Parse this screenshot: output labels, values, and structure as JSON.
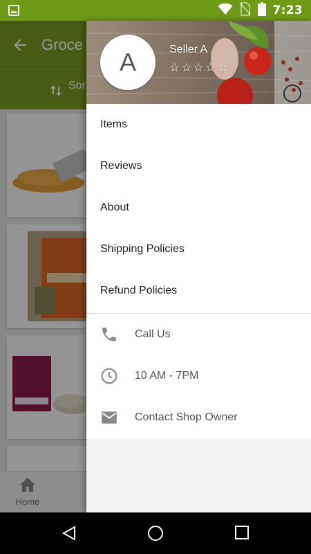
{
  "status_bar": {
    "time": "7:23"
  },
  "background_app": {
    "title": "Groce",
    "sort_label": "Sor",
    "bottom_nav": {
      "home_label": "Home"
    }
  },
  "drawer": {
    "header": {
      "avatar_letter": "A",
      "seller_name": "Seller A",
      "rating_stars": 0,
      "stars": [
        "☆",
        "☆",
        "☆",
        "☆",
        "☆"
      ]
    },
    "menu_items": [
      {
        "label": "Items"
      },
      {
        "label": "Reviews"
      },
      {
        "label": "About"
      },
      {
        "label": "Shipping Policies"
      },
      {
        "label": "Refund Policies"
      }
    ],
    "contact_items": [
      {
        "icon": "phone-icon",
        "label": "Call Us"
      },
      {
        "icon": "clock-icon",
        "label": "10 AM - 7PM"
      },
      {
        "icon": "mail-icon",
        "label": "Contact Shop Owner"
      }
    ]
  },
  "colors": {
    "status_bar": "#6f9a17",
    "app_bar": "#7c9f24",
    "drawer_bg": "#f4f4f4"
  }
}
